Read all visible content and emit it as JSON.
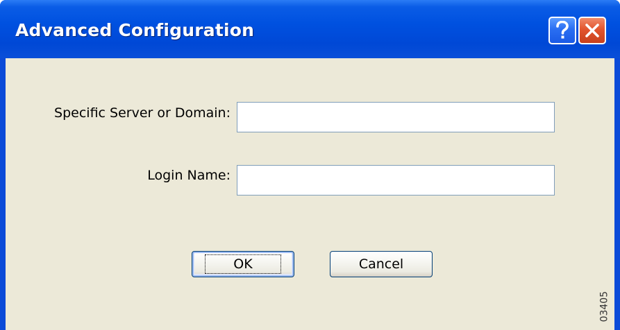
{
  "window": {
    "title": "Advanced Configuration",
    "help_glyph": "?",
    "close_glyph": "✕",
    "accent_color": "#0054e3",
    "close_color": "#e2552e",
    "face_color": "#ece9d8"
  },
  "form": {
    "server_label": "Specific Server or Domain:",
    "server_value": "",
    "login_label": "Login Name:",
    "login_value": ""
  },
  "buttons": {
    "ok_label": "OK",
    "cancel_label": "Cancel"
  },
  "side_mark": "03405"
}
